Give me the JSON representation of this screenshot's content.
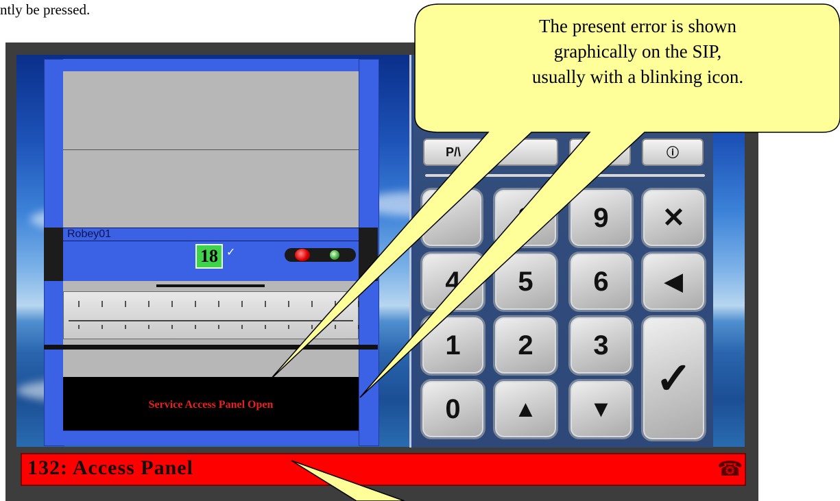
{
  "doc_text": "ntly be pressed.",
  "robot": {
    "name": "Robey01",
    "slot_counter": "18",
    "check_mark": "✓",
    "message": "Service Access Panel Open"
  },
  "keypad": {
    "function_buttons": [
      {
        "label": "P/\\",
        "icon": "p-m-label"
      },
      {
        "label": "",
        "icon": "blank"
      },
      {
        "label": "⚒",
        "icon": "tools-icon"
      },
      {
        "label": "ⓘ",
        "icon": "info-icon"
      }
    ],
    "keys": {
      "k8": "8",
      "k9": "9",
      "kx": "✕",
      "k4": "4",
      "k5": "5",
      "k6": "6",
      "kback": "◀",
      "k1": "1",
      "k2": "2",
      "k3": "3",
      "kenter": "✓",
      "k0": "0",
      "kup": "▲",
      "kdown": "▼"
    }
  },
  "status": {
    "text": "132: Access Panel",
    "phone_icon": "☎"
  },
  "callouts": {
    "top": {
      "line1": "The present error is shown",
      "line2": "graphically on the SIP,",
      "line3": "usually with a blinking icon."
    }
  },
  "colors": {
    "cabinet_blue": "#3b62e4",
    "status_red": "#ff0000",
    "callout_yellow": "#ffff9a",
    "message_red": "#e82020",
    "counter_green": "#3fd34b"
  }
}
